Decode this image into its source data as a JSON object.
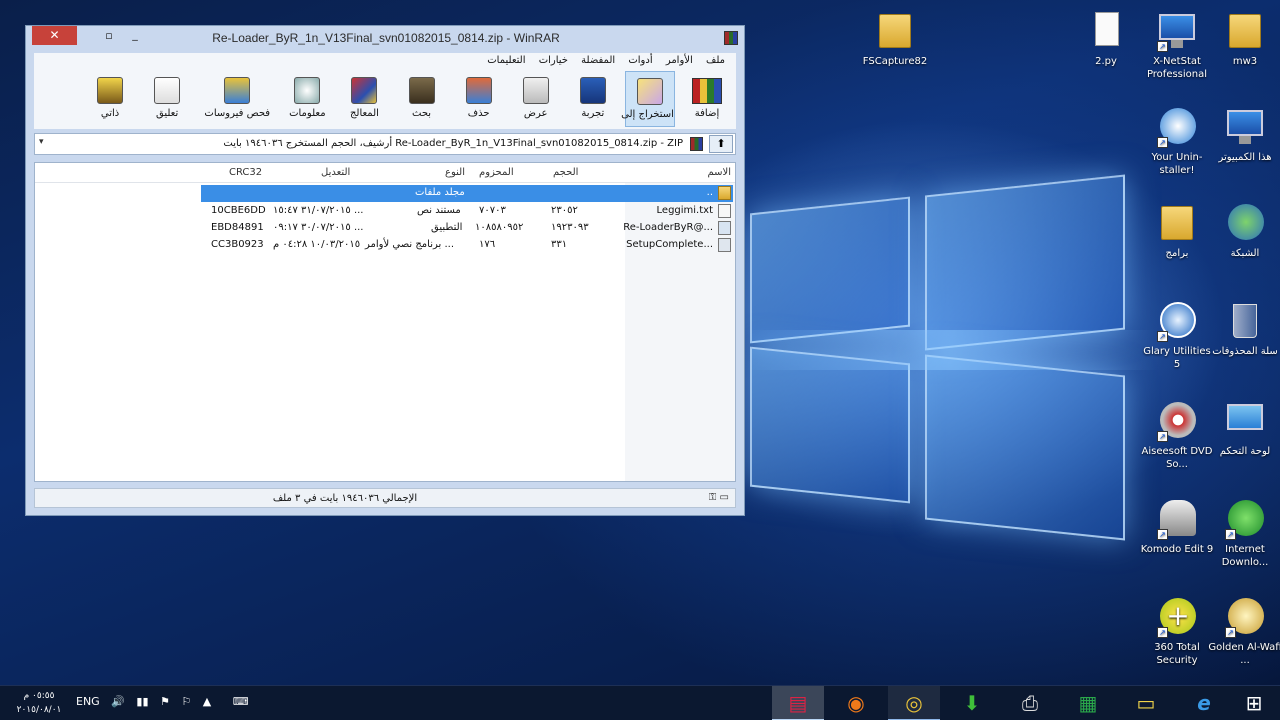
{
  "desktop": {
    "icons": [
      {
        "label": "FSCapture82"
      },
      {
        "label": "2.py"
      },
      {
        "label": "X-NetStat Professional"
      },
      {
        "label": "mw3"
      },
      {
        "label": "Your Unin-staller!"
      },
      {
        "label": "هذا الكمبيوتر"
      },
      {
        "label": "برامج"
      },
      {
        "label": "الشبكة"
      },
      {
        "label": "Glary Utilities 5"
      },
      {
        "label": "سلة المحذوفات"
      },
      {
        "label": "Aiseesoft DVD So..."
      },
      {
        "label": "لوحة التحكم"
      },
      {
        "label": "Komodo Edit 9"
      },
      {
        "label": "Internet Downlo..."
      },
      {
        "label": "360 Total Security"
      },
      {
        "label": "Golden Al-Wafi ..."
      }
    ]
  },
  "winrar": {
    "title": "Re-Loader_ByR_1n_V13Final_svn01082015_0814.zip - WinRAR",
    "close_symbol": "✕",
    "max_symbol": "▫",
    "min_symbol": "_",
    "menu": [
      "ملف",
      "الأوامر",
      "أدوات",
      "المفضلة",
      "خيارات",
      "التعليمات"
    ],
    "toolbar": [
      {
        "label": "إضافة",
        "icon": "add-archive-icon"
      },
      {
        "label": "استخراج إلى",
        "icon": "extract-to-icon"
      },
      {
        "label": "تجربة",
        "icon": "test-icon"
      },
      {
        "label": "عرض",
        "icon": "view-icon"
      },
      {
        "label": "حذف",
        "icon": "delete-icon"
      },
      {
        "label": "بحث",
        "icon": "find-icon"
      },
      {
        "label": "المعالج",
        "icon": "wizard-icon"
      },
      {
        "label": "معلومات",
        "icon": "info-icon"
      },
      {
        "label": "فحص فيروسات",
        "icon": "virus-scan-icon"
      },
      {
        "label": "تعليق",
        "icon": "comment-icon"
      },
      {
        "label": "ذاتي",
        "icon": "sfx-icon"
      }
    ],
    "address": "Re-Loader_ByR_1n_V13Final_svn01082015_0814.zip - ZIP أرشيف، الحجم المستخرج ١٩٤٦٠٣٦ بايت",
    "address_dropdown": "▾",
    "up_symbol": "⬆",
    "columns": {
      "name": "الاسم",
      "size": "الحجم",
      "packed": "المحزوم",
      "type": "النوع",
      "modified": "التعديل",
      "crc": "CRC32"
    },
    "rows": [
      {
        "name": "..",
        "size": "",
        "packed": "",
        "type": "مجلد ملفات",
        "modified": "",
        "crc": "",
        "selected": true,
        "icon": "folder"
      },
      {
        "name": "Leggimi.txt",
        "size": "٢٣٠٥٢",
        "packed": "٧٠٧٠٣",
        "type": "مستند نص",
        "modified": "٣١/٠٧/٢٠١٥ ١٥:٤٧ ...",
        "crc": "10CBE6DD",
        "selected": false,
        "icon": "text"
      },
      {
        "name": "Re-LoaderByR@...",
        "size": "١٩٢٣٠٩٣",
        "packed": "١٠٨٥٨٠٩٥٢",
        "type": "التطبيق",
        "modified": "٣٠/٠٧/٢٠١٥ ٠٩:١٧ ...",
        "crc": "EBD84891",
        "selected": false,
        "icon": "exe"
      },
      {
        "name": "SetupComplete...",
        "size": "٣٣١",
        "packed": "١٧٦",
        "type": "برنامج نصي لأوامر ...",
        "modified": "١٠/٠٣/٢٠١٥ ٠٤:٢٨ م",
        "crc": "CC3B0923",
        "selected": false,
        "icon": "cmd"
      }
    ],
    "status": "الإجمالي ١٩٤٦٠٣٦ بايت في ٣ ملف",
    "status_icons": "⚿ ▭"
  },
  "taskbar": {
    "time": "٠٥:٥٥ م",
    "date": "٢٠١٥/٠٨/٠١",
    "lang": "ENG",
    "tray": [
      "🔊",
      "▮▮",
      "⚑",
      "⚐",
      "▲"
    ],
    "keyboard": "⌨",
    "apps": [
      {
        "name": "winrar",
        "glyph": "▤"
      },
      {
        "name": "firefox",
        "glyph": "◉"
      },
      {
        "name": "chrome",
        "glyph": "◎"
      },
      {
        "name": "internet-download-manager",
        "glyph": "⬇"
      },
      {
        "name": "printer",
        "glyph": "⎙"
      },
      {
        "name": "excel",
        "glyph": "▦"
      },
      {
        "name": "explorer",
        "glyph": "▭"
      },
      {
        "name": "internet-explorer",
        "glyph": "e"
      },
      {
        "name": "start",
        "glyph": "⊞"
      }
    ]
  },
  "colors": {
    "selection": "#3a8ee6",
    "close": "#c7423a",
    "window_frame": "#c9d8ee"
  }
}
